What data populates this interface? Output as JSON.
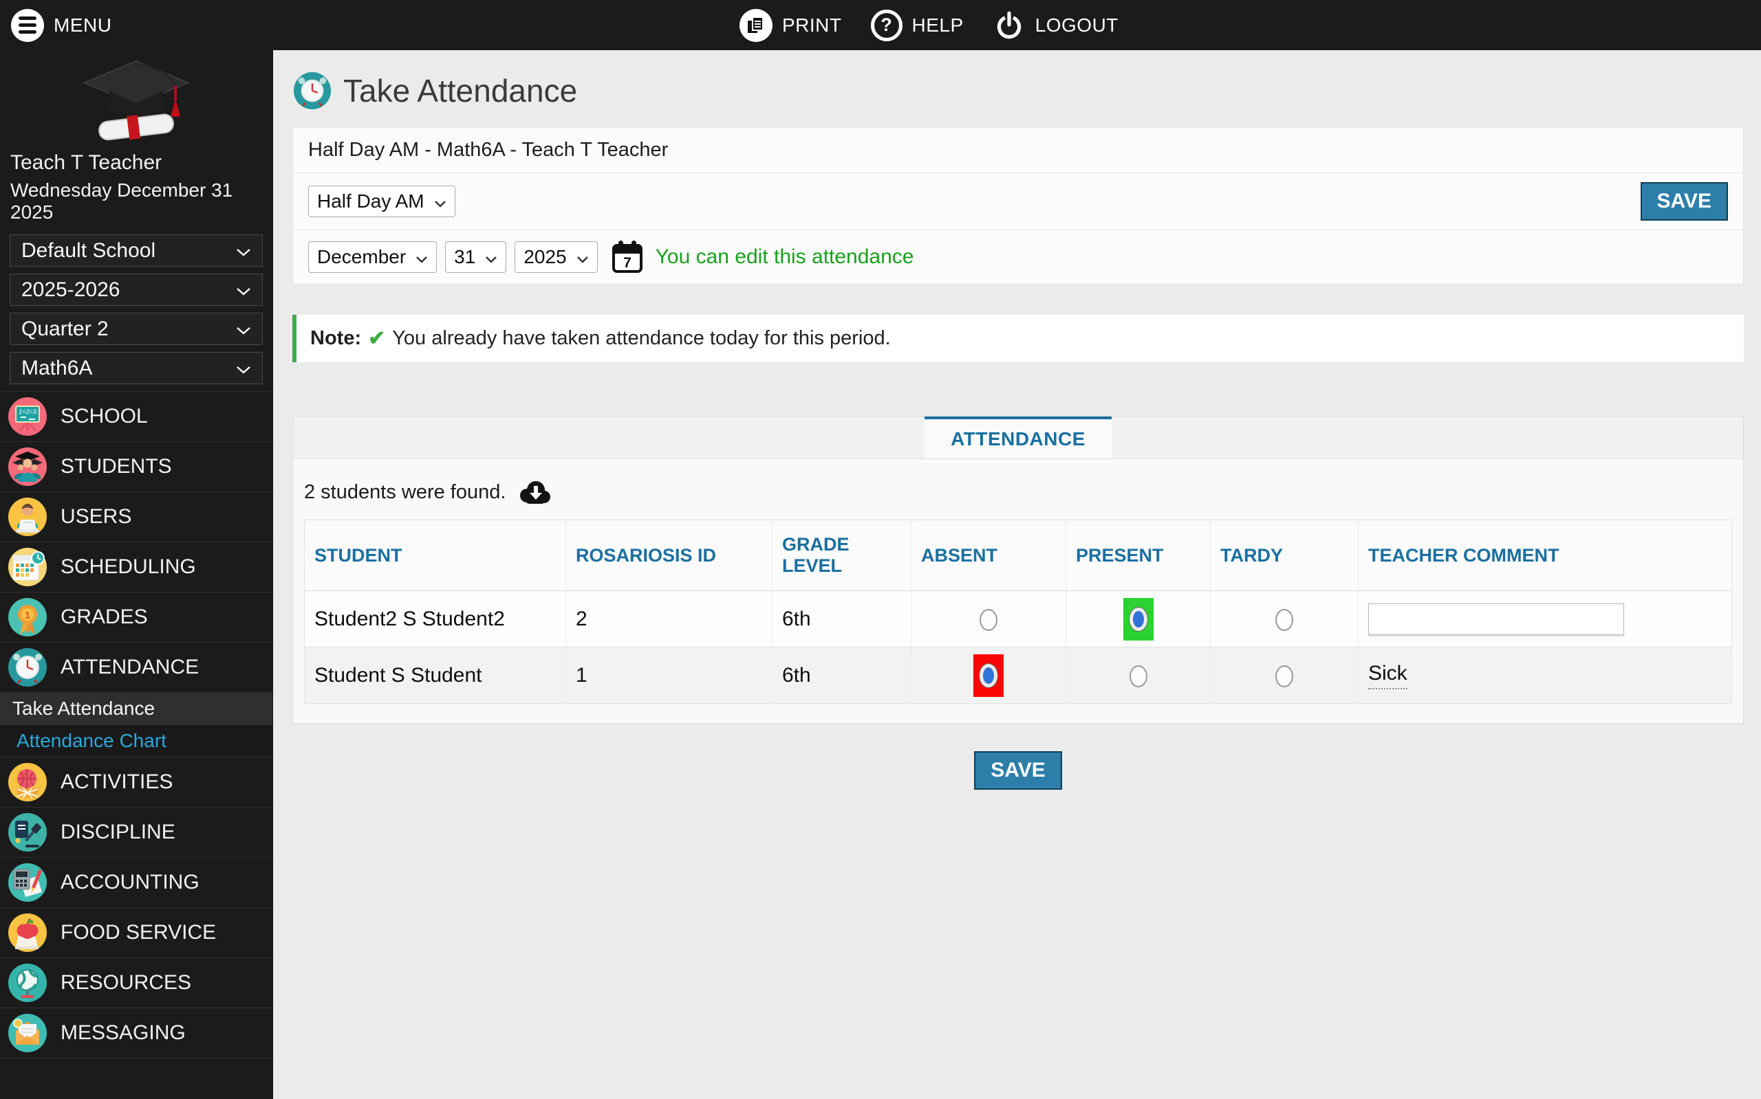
{
  "topbar": {
    "menu_label": "MENU",
    "print_label": "PRINT",
    "help_label": "HELP",
    "logout_label": "LOGOUT"
  },
  "icons": {
    "help_glyph": "?",
    "check_glyph": "✔",
    "calendar_glyph": "7",
    "school_board_text": "1+2=3",
    "grades_badge": "1"
  },
  "sidebar": {
    "user_name": "Teach T Teacher",
    "date": "Wednesday December 31 2025",
    "selectors": [
      {
        "value": "Default School"
      },
      {
        "value": "2025-2026"
      },
      {
        "value": "Quarter 2"
      },
      {
        "value": "Math6A"
      }
    ],
    "modules": [
      {
        "label": "SCHOOL",
        "icon": "school-icon"
      },
      {
        "label": "STUDENTS",
        "icon": "students-icon"
      },
      {
        "label": "USERS",
        "icon": "users-icon"
      },
      {
        "label": "SCHEDULING",
        "icon": "scheduling-icon"
      },
      {
        "label": "GRADES",
        "icon": "grades-icon"
      },
      {
        "label": "ATTENDANCE",
        "icon": "attendance-icon"
      },
      {
        "label": "ACTIVITIES",
        "icon": "activities-icon"
      },
      {
        "label": "DISCIPLINE",
        "icon": "discipline-icon"
      },
      {
        "label": "ACCOUNTING",
        "icon": "accounting-icon"
      },
      {
        "label": "FOOD SERVICE",
        "icon": "food-service-icon"
      },
      {
        "label": "RESOURCES",
        "icon": "resources-icon"
      },
      {
        "label": "MESSAGING",
        "icon": "messaging-icon"
      }
    ],
    "submenu": [
      {
        "label": "Take Attendance",
        "state": "active"
      },
      {
        "label": "Attendance Chart",
        "state": "link"
      }
    ]
  },
  "main": {
    "page_title": "Take Attendance",
    "context_line": "Half Day AM - Math6A - Teach T Teacher",
    "period_select_value": "Half Day AM",
    "save_label": "SAVE",
    "date_month": "December",
    "date_day": "31",
    "date_year": "2025",
    "edit_hint": "You can edit this attendance",
    "note_label": "Note:",
    "note_text": "You already have taken attendance today for this period.",
    "tab_label": "ATTENDANCE",
    "students_found": "2 students were found.",
    "table": {
      "headers": [
        "STUDENT",
        "ROSARIOSIS ID",
        "GRADE LEVEL",
        "ABSENT",
        "PRESENT",
        "TARDY",
        "TEACHER COMMENT"
      ],
      "rows": [
        {
          "student": "Student2 S Student2",
          "id": "2",
          "grade": "6th",
          "status": "present",
          "comment": ""
        },
        {
          "student": "Student S Student",
          "id": "1",
          "grade": "6th",
          "status": "absent",
          "comment": "Sick"
        }
      ]
    },
    "bottom_save_label": "SAVE"
  },
  "colors": {
    "accent_blue": "#1a6fa0",
    "button_blue": "#2d7ea9",
    "present_green": "#2bd232",
    "absent_red": "#fb0606",
    "success_green": "#18a21c",
    "link_blue": "#2aa8dc",
    "bar_dark": "#1b1b1b"
  }
}
